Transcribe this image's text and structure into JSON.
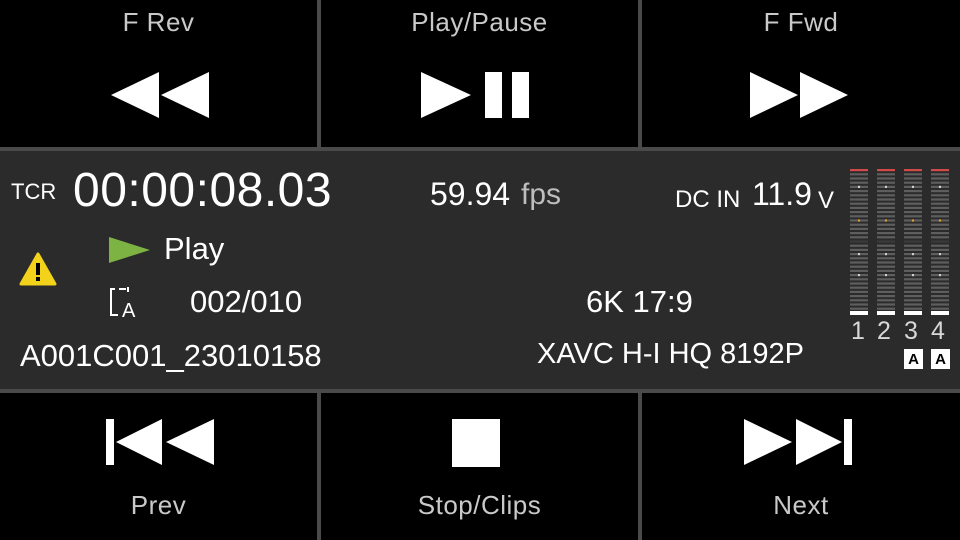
{
  "transport_top": {
    "frev_label": "F Rev",
    "play_pause_label": "Play/Pause",
    "ffwd_label": "F Fwd"
  },
  "transport_bottom": {
    "prev_label": "Prev",
    "stop_label": "Stop/Clips",
    "next_label": "Next"
  },
  "info": {
    "tcr_label": "TCR",
    "timecode": "00:00:08.03",
    "fps_value": "59.94",
    "fps_unit": "fps",
    "dc_label": "DC IN",
    "dc_value": "11.9",
    "dc_unit": "V",
    "status": "Play",
    "clip_count": "002/010",
    "resolution": "6K 17:9",
    "clip_name": "A001C001_23010158",
    "codec": "XAVC H-I HQ 8192P",
    "warning_icon": "warning-triangle-icon",
    "status_icon": "play-arrow-icon",
    "clip_icon": "clip-media-icon"
  },
  "audio_meters": {
    "channels": [
      "1",
      "2",
      "3",
      "4"
    ],
    "auto_badges": [
      "A",
      "A"
    ]
  },
  "colors": {
    "button_bg": "#000000",
    "panel_bg": "#2b2b2b",
    "divider": "#4a4a4a",
    "play_green": "#7cb342",
    "warning_yellow": "#f2d21b",
    "meter_peak": "#d04a4a",
    "meter_ref": "#e0a030"
  }
}
